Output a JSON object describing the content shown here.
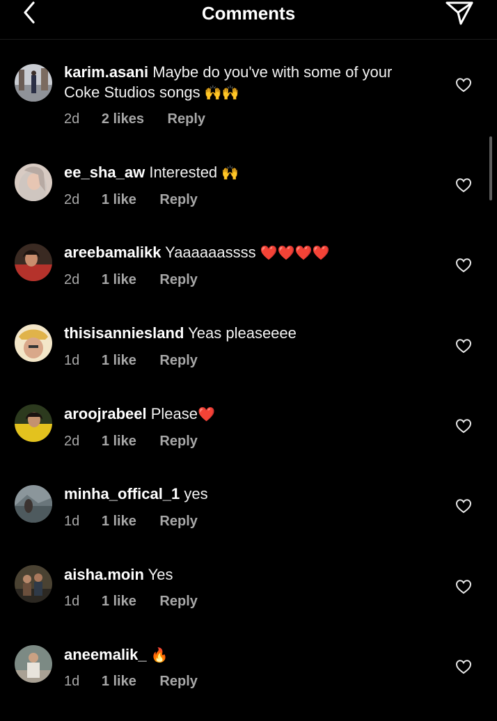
{
  "header": {
    "title": "Comments",
    "back_icon": "chevron-left-icon",
    "share_icon": "paper-plane-icon"
  },
  "comments": [
    {
      "username": "karim.asani",
      "text": "Maybe do you've with some of your Coke Studios songs",
      "emoji": "🙌🙌",
      "time": "2d",
      "likes": "2 likes",
      "reply": "Reply"
    },
    {
      "username": "ee_sha_aw",
      "text": "Interested",
      "emoji": "🙌",
      "time": "2d",
      "likes": "1 like",
      "reply": "Reply"
    },
    {
      "username": "areebamalikk",
      "text": "Yaaaaaassss",
      "emoji": "❤️❤️❤️❤️",
      "time": "2d",
      "likes": "1 like",
      "reply": "Reply"
    },
    {
      "username": "thisisanniesland",
      "text": "Yeas pleaseeee",
      "emoji": "",
      "time": "1d",
      "likes": "1 like",
      "reply": "Reply"
    },
    {
      "username": "aroojrabeel",
      "text": "Please",
      "emoji": "❤️",
      "time": "2d",
      "likes": "1 like",
      "reply": "Reply"
    },
    {
      "username": "minha_offical_1",
      "text": "yes",
      "emoji": "",
      "time": "1d",
      "likes": "1 like",
      "reply": "Reply"
    },
    {
      "username": "aisha.moin",
      "text": "Yes",
      "emoji": "",
      "time": "1d",
      "likes": "1 like",
      "reply": "Reply"
    },
    {
      "username": "aneemalik_",
      "text": "",
      "emoji": "🔥",
      "time": "1d",
      "likes": "1 like",
      "reply": "Reply"
    }
  ],
  "colors": {
    "background": "#000000",
    "text": "#f5f5f5",
    "secondary": "#a8a8a8",
    "heart": "#ff1f3d"
  }
}
